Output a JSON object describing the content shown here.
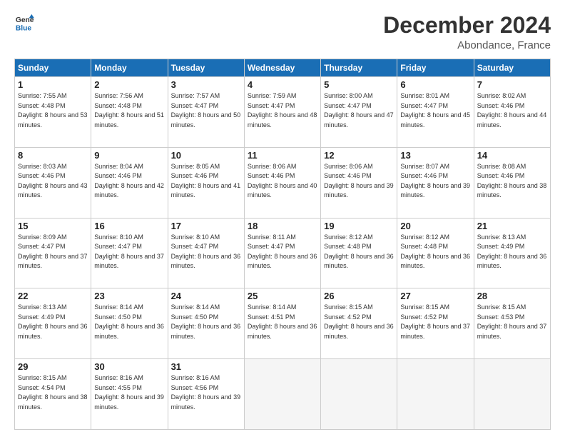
{
  "logo": {
    "line1": "General",
    "line2": "Blue"
  },
  "title": "December 2024",
  "subtitle": "Abondance, France",
  "headers": [
    "Sunday",
    "Monday",
    "Tuesday",
    "Wednesday",
    "Thursday",
    "Friday",
    "Saturday"
  ],
  "weeks": [
    [
      {
        "day": "1",
        "sunrise": "7:55 AM",
        "sunset": "4:48 PM",
        "daylight": "8 hours and 53 minutes."
      },
      {
        "day": "2",
        "sunrise": "7:56 AM",
        "sunset": "4:48 PM",
        "daylight": "8 hours and 51 minutes."
      },
      {
        "day": "3",
        "sunrise": "7:57 AM",
        "sunset": "4:47 PM",
        "daylight": "8 hours and 50 minutes."
      },
      {
        "day": "4",
        "sunrise": "7:59 AM",
        "sunset": "4:47 PM",
        "daylight": "8 hours and 48 minutes."
      },
      {
        "day": "5",
        "sunrise": "8:00 AM",
        "sunset": "4:47 PM",
        "daylight": "8 hours and 47 minutes."
      },
      {
        "day": "6",
        "sunrise": "8:01 AM",
        "sunset": "4:47 PM",
        "daylight": "8 hours and 45 minutes."
      },
      {
        "day": "7",
        "sunrise": "8:02 AM",
        "sunset": "4:46 PM",
        "daylight": "8 hours and 44 minutes."
      }
    ],
    [
      {
        "day": "8",
        "sunrise": "8:03 AM",
        "sunset": "4:46 PM",
        "daylight": "8 hours and 43 minutes."
      },
      {
        "day": "9",
        "sunrise": "8:04 AM",
        "sunset": "4:46 PM",
        "daylight": "8 hours and 42 minutes."
      },
      {
        "day": "10",
        "sunrise": "8:05 AM",
        "sunset": "4:46 PM",
        "daylight": "8 hours and 41 minutes."
      },
      {
        "day": "11",
        "sunrise": "8:06 AM",
        "sunset": "4:46 PM",
        "daylight": "8 hours and 40 minutes."
      },
      {
        "day": "12",
        "sunrise": "8:06 AM",
        "sunset": "4:46 PM",
        "daylight": "8 hours and 39 minutes."
      },
      {
        "day": "13",
        "sunrise": "8:07 AM",
        "sunset": "4:46 PM",
        "daylight": "8 hours and 39 minutes."
      },
      {
        "day": "14",
        "sunrise": "8:08 AM",
        "sunset": "4:46 PM",
        "daylight": "8 hours and 38 minutes."
      }
    ],
    [
      {
        "day": "15",
        "sunrise": "8:09 AM",
        "sunset": "4:47 PM",
        "daylight": "8 hours and 37 minutes."
      },
      {
        "day": "16",
        "sunrise": "8:10 AM",
        "sunset": "4:47 PM",
        "daylight": "8 hours and 37 minutes."
      },
      {
        "day": "17",
        "sunrise": "8:10 AM",
        "sunset": "4:47 PM",
        "daylight": "8 hours and 36 minutes."
      },
      {
        "day": "18",
        "sunrise": "8:11 AM",
        "sunset": "4:47 PM",
        "daylight": "8 hours and 36 minutes."
      },
      {
        "day": "19",
        "sunrise": "8:12 AM",
        "sunset": "4:48 PM",
        "daylight": "8 hours and 36 minutes."
      },
      {
        "day": "20",
        "sunrise": "8:12 AM",
        "sunset": "4:48 PM",
        "daylight": "8 hours and 36 minutes."
      },
      {
        "day": "21",
        "sunrise": "8:13 AM",
        "sunset": "4:49 PM",
        "daylight": "8 hours and 36 minutes."
      }
    ],
    [
      {
        "day": "22",
        "sunrise": "8:13 AM",
        "sunset": "4:49 PM",
        "daylight": "8 hours and 36 minutes."
      },
      {
        "day": "23",
        "sunrise": "8:14 AM",
        "sunset": "4:50 PM",
        "daylight": "8 hours and 36 minutes."
      },
      {
        "day": "24",
        "sunrise": "8:14 AM",
        "sunset": "4:50 PM",
        "daylight": "8 hours and 36 minutes."
      },
      {
        "day": "25",
        "sunrise": "8:14 AM",
        "sunset": "4:51 PM",
        "daylight": "8 hours and 36 minutes."
      },
      {
        "day": "26",
        "sunrise": "8:15 AM",
        "sunset": "4:52 PM",
        "daylight": "8 hours and 36 minutes."
      },
      {
        "day": "27",
        "sunrise": "8:15 AM",
        "sunset": "4:52 PM",
        "daylight": "8 hours and 37 minutes."
      },
      {
        "day": "28",
        "sunrise": "8:15 AM",
        "sunset": "4:53 PM",
        "daylight": "8 hours and 37 minutes."
      }
    ],
    [
      {
        "day": "29",
        "sunrise": "8:15 AM",
        "sunset": "4:54 PM",
        "daylight": "8 hours and 38 minutes."
      },
      {
        "day": "30",
        "sunrise": "8:16 AM",
        "sunset": "4:55 PM",
        "daylight": "8 hours and 39 minutes."
      },
      {
        "day": "31",
        "sunrise": "8:16 AM",
        "sunset": "4:56 PM",
        "daylight": "8 hours and 39 minutes."
      },
      null,
      null,
      null,
      null
    ]
  ]
}
